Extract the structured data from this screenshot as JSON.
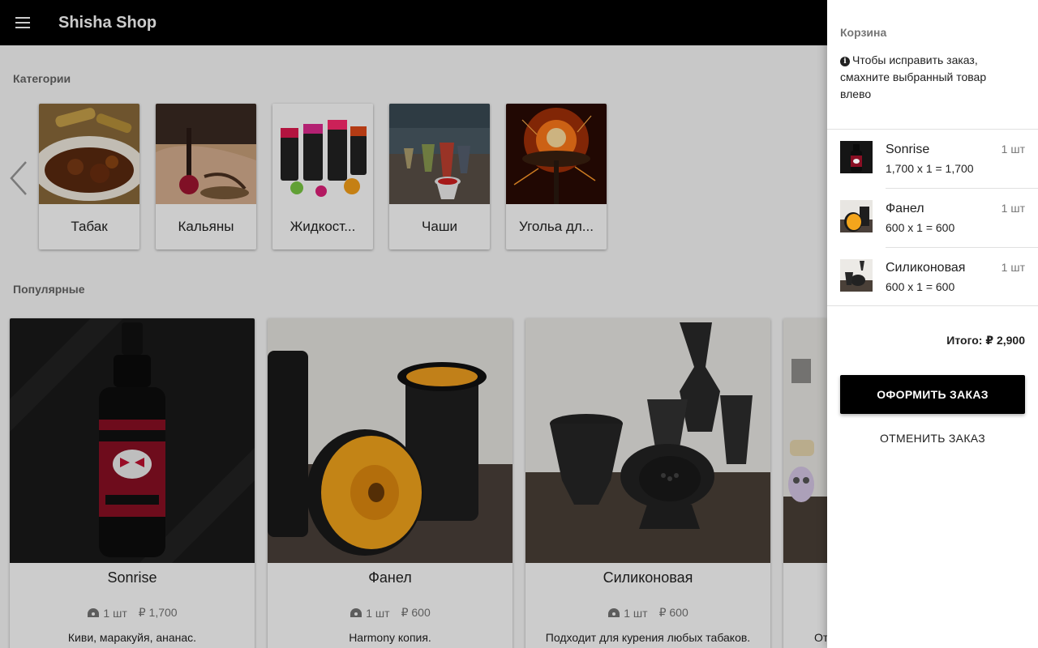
{
  "app": {
    "title": "Shisha Shop",
    "menu_icon": "menu-icon"
  },
  "categories": {
    "title": "Категории",
    "prev_icon": "chevron-left-icon",
    "items": [
      {
        "label": "Табак"
      },
      {
        "label": "Кальяны"
      },
      {
        "label": "Жидкост..."
      },
      {
        "label": "Чаши"
      },
      {
        "label": "Угольа дл..."
      }
    ]
  },
  "popular": {
    "title": "Популярные",
    "items": [
      {
        "name": "Sonrise",
        "qty": "1 шт",
        "price": "₽ 1,700",
        "desc": "Киви, маракуйя, ананас."
      },
      {
        "name": "Фанел",
        "qty": "1 шт",
        "price": "₽ 600",
        "desc": "Harmony копия."
      },
      {
        "name": "Силиконовая",
        "qty": "1 шт",
        "price": "₽ 600",
        "desc": "Подходит для курения любых табаков."
      },
      {
        "name": "",
        "qty": "",
        "price": "",
        "desc": "От"
      }
    ]
  },
  "cart": {
    "title": "Корзина",
    "hint": "Чтобы исправить заказ, смахните выбранный товар влево",
    "items": [
      {
        "name": "Sonrise",
        "calc": "1,700 x 1 = 1,700",
        "qty": "1 шт"
      },
      {
        "name": "Фанел",
        "calc": "600 x 1 = 600",
        "qty": "1 шт"
      },
      {
        "name": "Силиконовая",
        "calc": "600 x 1 = 600",
        "qty": "1 шт"
      }
    ],
    "total": "Итого: ₽ 2,900",
    "order_label": "ОФОРМИТЬ ЗАКАЗ",
    "cancel_label": "ОТМЕНИТЬ ЗАКАЗ"
  },
  "colors": {
    "appbar": "#000000",
    "accent": "#000000",
    "scrim": "rgba(0,0,0,0.2)"
  }
}
